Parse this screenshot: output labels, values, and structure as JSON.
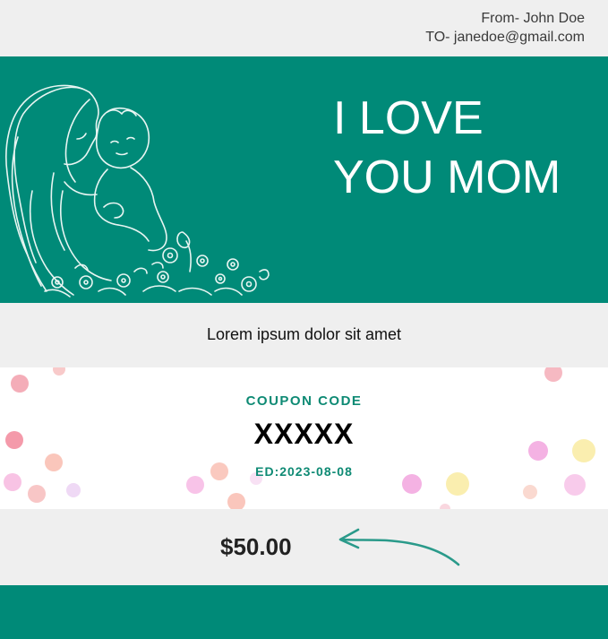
{
  "header": {
    "from": "From- John Doe",
    "to": "TO- janedoe@gmail.com"
  },
  "hero": {
    "title_line1": "I LOVE",
    "title_line2": "YOU MOM",
    "illustration": "mother-and-child-line-art",
    "background_color": "#008a78"
  },
  "message": {
    "text": "Lorem ipsum dolor sit amet"
  },
  "coupon": {
    "label": "COUPON CODE",
    "code": "XXXXX",
    "expiry": "ED:2023-08-08",
    "accent_color": "#0e8a74"
  },
  "price": {
    "amount": "$50.00",
    "arrow_icon": "arrow-left-icon"
  }
}
